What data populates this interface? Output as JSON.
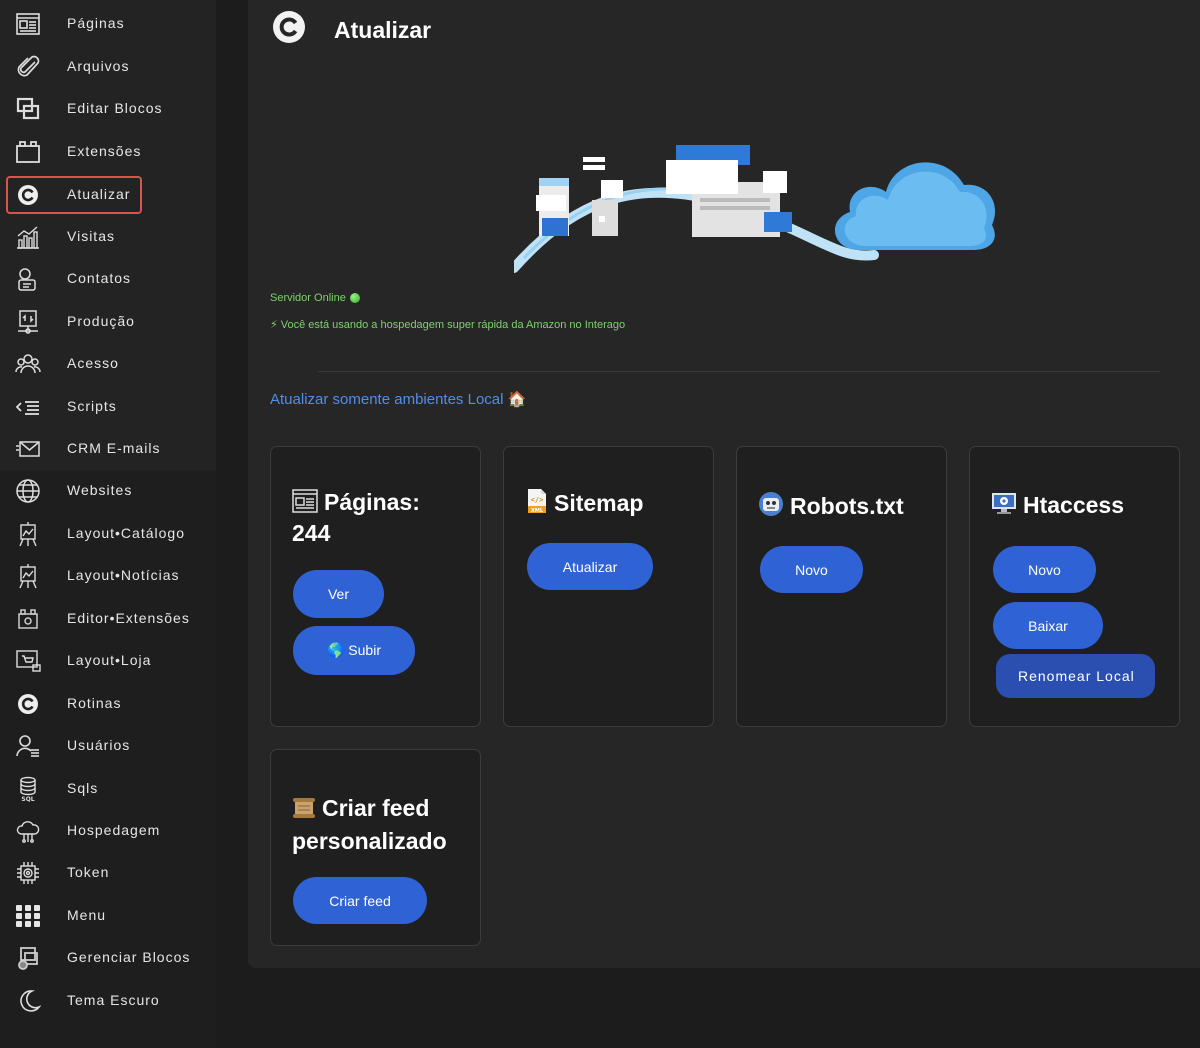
{
  "sidebar": {
    "items": [
      {
        "label": "Páginas",
        "icon": "pages-icon"
      },
      {
        "label": "Arquivos",
        "icon": "paperclip-icon"
      },
      {
        "label": "Editar Blocos",
        "icon": "blocks-icon"
      },
      {
        "label": "Extensões",
        "icon": "extension-icon"
      },
      {
        "label": "Atualizar",
        "icon": "refresh-icon",
        "active": true
      },
      {
        "label": "Visitas",
        "icon": "analytics-icon"
      },
      {
        "label": "Contatos",
        "icon": "contacts-icon"
      },
      {
        "label": "Produção",
        "icon": "production-icon"
      },
      {
        "label": "Acesso",
        "icon": "users-group-icon"
      },
      {
        "label": "Scripts",
        "icon": "code-icon"
      },
      {
        "label": "CRM E-mails",
        "icon": "mail-icon"
      },
      {
        "label": "Websites",
        "icon": "globe-icon"
      },
      {
        "label": "Layout•Catálogo",
        "icon": "easel-icon"
      },
      {
        "label": "Layout•Notícias",
        "icon": "easel-icon"
      },
      {
        "label": "Editor•Extensões",
        "icon": "extension-gear-icon"
      },
      {
        "label": "Layout•Loja",
        "icon": "shop-icon"
      },
      {
        "label": "Rotinas",
        "icon": "refresh-icon"
      },
      {
        "label": "Usuários",
        "icon": "user-list-icon"
      },
      {
        "label": "Sqls",
        "icon": "database-icon"
      },
      {
        "label": "Hospedagem",
        "icon": "cloud-icon"
      },
      {
        "label": "Token",
        "icon": "chip-icon"
      },
      {
        "label": "Menu",
        "icon": "grid-icon"
      },
      {
        "label": "Gerenciar Blocos",
        "icon": "blocks-gear-icon"
      },
      {
        "label": "Tema Escuro",
        "icon": "moon-icon"
      }
    ]
  },
  "header": {
    "title": "Atualizar"
  },
  "status": {
    "server": "Servidor Online",
    "hosting": "⚡ Você está usando a hospedagem super rápida da Amazon no Interago"
  },
  "local_link": "Atualizar somente ambientes Local 🏠",
  "cards": {
    "pages": {
      "title": "Páginas:",
      "count": "244",
      "view_label": "Ver",
      "upload_label": "🌎 Subir"
    },
    "sitemap": {
      "title": "Sitemap",
      "update_label": "Atualizar"
    },
    "robots": {
      "title": "Robots.txt",
      "new_label": "Novo"
    },
    "htaccess": {
      "title": "Htaccess",
      "new_label": "Novo",
      "download_label": "Baixar",
      "rename_label": "Renomear Local"
    },
    "feed": {
      "title": "Criar feed personalizado",
      "create_label": "Criar feed"
    }
  },
  "colors": {
    "accent": "#2f62d4",
    "active_border": "#d9534f",
    "status_green": "#7bd36b",
    "link_blue": "#4f8fe8"
  }
}
